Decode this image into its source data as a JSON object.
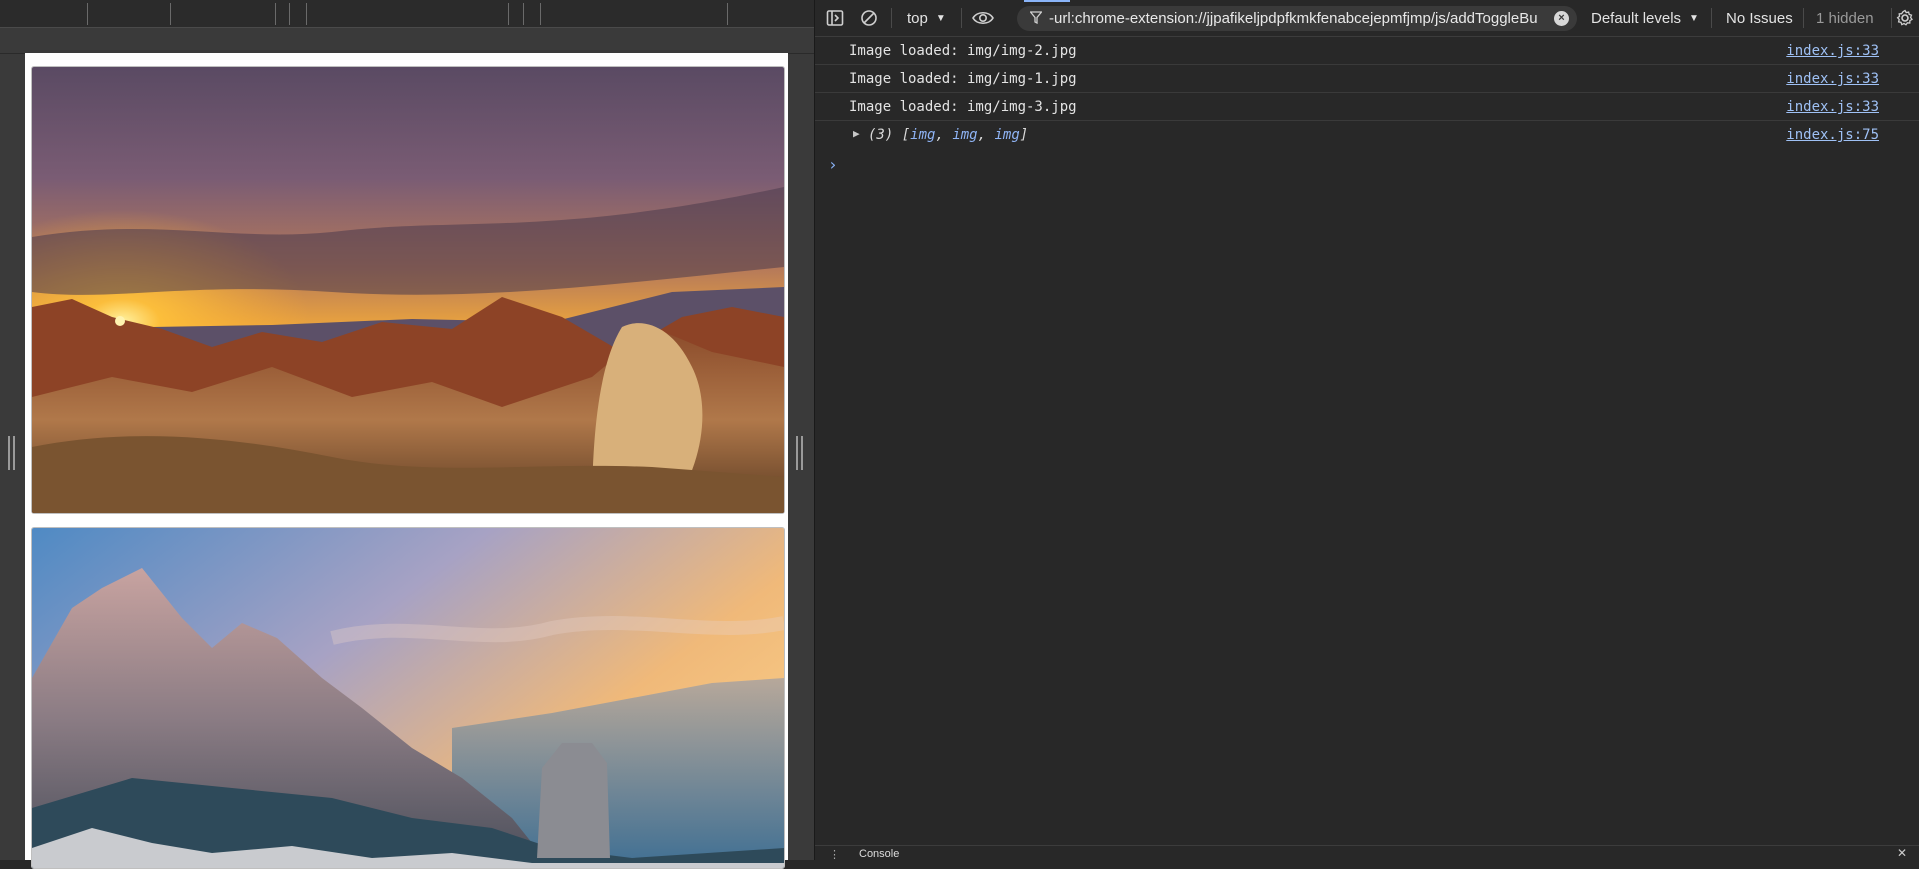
{
  "devtools": {
    "toolbar": {
      "context": "top",
      "filter_text": "-url:chrome-extension://jjpafikeljpdpfkmkfenabcejepmfjmp/js/addToggleBu",
      "levels": "Default levels",
      "issues": "No Issues",
      "hidden": "1 hidden"
    },
    "console": {
      "logs": [
        {
          "message": "Image loaded: img/img-2.jpg",
          "source": "index.js:33"
        },
        {
          "message": "Image loaded: img/img-1.jpg",
          "source": "index.js:33"
        },
        {
          "message": "Image loaded: img/img-3.jpg",
          "source": "index.js:33"
        }
      ],
      "array_log": {
        "count": "(3)",
        "open": "[",
        "items": [
          "img",
          "img",
          "img"
        ],
        "close": "]",
        "source": "index.js:75"
      },
      "prompt": "›"
    },
    "bottom": {
      "tab": "Console"
    }
  },
  "viewport": {
    "images": [
      {
        "name": "desert-sunset-rocks"
      },
      {
        "name": "dolomites-mountain-sunrise"
      }
    ]
  },
  "colors": {
    "accent": "#8ab4f8",
    "link": "#9fc1f5",
    "bg": "#282828"
  }
}
